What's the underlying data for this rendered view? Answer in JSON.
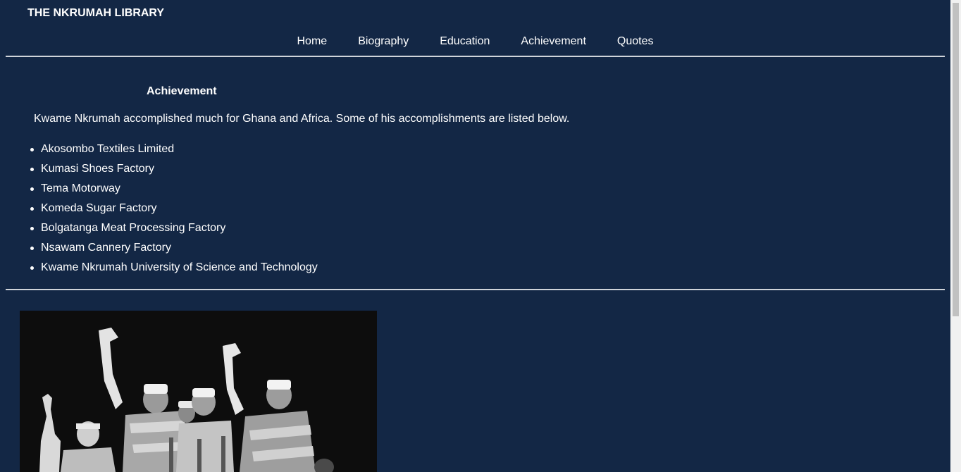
{
  "site": {
    "title": "THE NKRUMAH LIBRARY"
  },
  "nav": {
    "items": [
      {
        "label": "Home"
      },
      {
        "label": "Biography"
      },
      {
        "label": "Education"
      },
      {
        "label": "Achievement"
      },
      {
        "label": "Quotes"
      }
    ]
  },
  "main": {
    "heading": "Achievement",
    "intro": "Kwame Nkrumah accomplished much for Ghana and Africa. Some of his accomplishments are listed below.",
    "accomplishments": [
      "Akosombo Textiles Limited",
      "Kumasi Shoes Factory",
      "Tema Motorway",
      "Komeda Sugar Factory",
      "Bolgatanga Meat Processing Factory",
      "Nsawam Cannery Factory",
      "Kwame Nkrumah University of Science and Technology"
    ]
  },
  "colors": {
    "background": "#132745",
    "text": "#ffffff",
    "rule": "#d0d4da"
  }
}
